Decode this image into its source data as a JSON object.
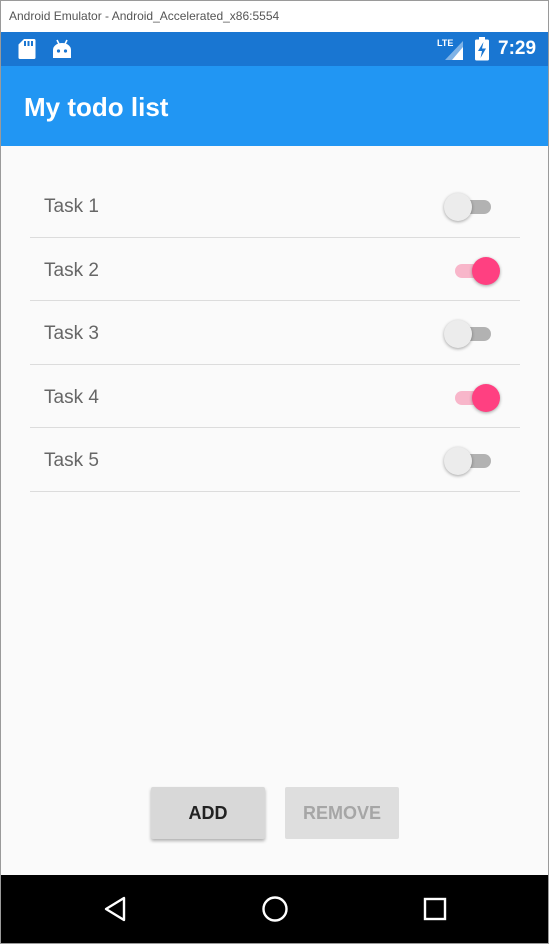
{
  "window": {
    "title": "Android Emulator - Android_Accelerated_x86:5554"
  },
  "status_bar": {
    "time": "7:29",
    "network_label": "LTE",
    "icons": [
      "sd-card-icon",
      "android-icon",
      "lte-signal-icon",
      "battery-charging-icon"
    ]
  },
  "app_bar": {
    "title": "My todo list"
  },
  "tasks": [
    {
      "label": "Task 1",
      "done": false
    },
    {
      "label": "Task 2",
      "done": true
    },
    {
      "label": "Task 3",
      "done": false
    },
    {
      "label": "Task 4",
      "done": true
    },
    {
      "label": "Task 5",
      "done": false
    }
  ],
  "buttons": {
    "add_label": "ADD",
    "remove_label": "REMOVE",
    "remove_enabled": false
  },
  "nav_bar": {
    "icons": [
      "back-icon",
      "home-icon",
      "recents-icon"
    ]
  },
  "colors": {
    "status_bar": "#1976d2",
    "app_bar": "#2196f3",
    "switch_on": "#ff4081",
    "switch_on_track": "#f8b6ca",
    "switch_off_thumb": "#ececec",
    "switch_off_track": "#b2b2b2"
  }
}
